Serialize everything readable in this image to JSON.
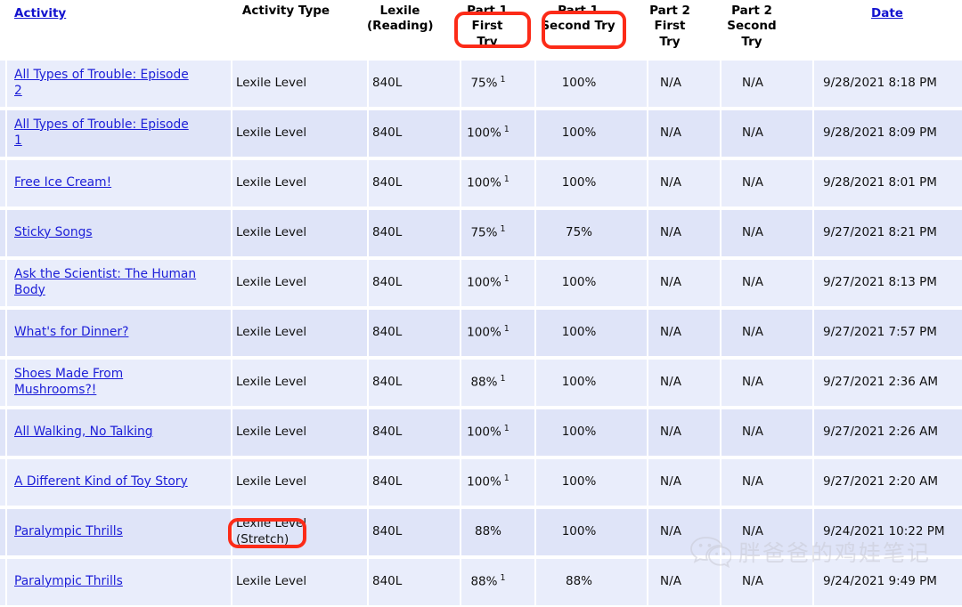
{
  "table": {
    "columns": [
      {
        "key": "activity",
        "label": "Activity",
        "type": "link",
        "align": "left"
      },
      {
        "key": "type",
        "label": "Activity Type",
        "type": "text",
        "align": "center"
      },
      {
        "key": "lexile",
        "label_line1": "Lexile",
        "label_line2": "(Reading)",
        "type": "text",
        "align": "center"
      },
      {
        "key": "p1first",
        "label_line1": "Part 1",
        "label_line2": "First Try",
        "type": "text",
        "align": "center"
      },
      {
        "key": "p1second",
        "label_line1": "Part 1",
        "label_line2": "Second Try",
        "type": "text",
        "align": "center"
      },
      {
        "key": "p2first",
        "label_line1": "Part 2",
        "label_line2": "First",
        "label_line3": "Try",
        "type": "text",
        "align": "center"
      },
      {
        "key": "p2second",
        "label_line1": "Part 2",
        "label_line2": "Second",
        "label_line3": "Try",
        "type": "text",
        "align": "center"
      },
      {
        "key": "date",
        "label": "Date",
        "type": "link",
        "align": "center"
      }
    ],
    "rows": [
      {
        "activity": "All Types of Trouble: Episode 2",
        "type": "Lexile Level",
        "type_sub": "",
        "lexile": "840L",
        "p1first": "75%",
        "p1first_sup": "1",
        "p1second": "100%",
        "p2first": "N/A",
        "p2second": "N/A",
        "date": "9/28/2021  8:18 PM"
      },
      {
        "activity": "All Types of Trouble: Episode 1",
        "type": "Lexile Level",
        "type_sub": "",
        "lexile": "840L",
        "p1first": "100%",
        "p1first_sup": "1",
        "p1second": "100%",
        "p2first": "N/A",
        "p2second": "N/A",
        "date": "9/28/2021  8:09 PM"
      },
      {
        "activity": "Free Ice Cream!",
        "type": "Lexile Level",
        "type_sub": "",
        "lexile": "840L",
        "p1first": "100%",
        "p1first_sup": "1",
        "p1second": "100%",
        "p2first": "N/A",
        "p2second": "N/A",
        "date": "9/28/2021  8:01 PM"
      },
      {
        "activity": "Sticky Songs",
        "type": "Lexile Level",
        "type_sub": "",
        "lexile": "840L",
        "p1first": "75%",
        "p1first_sup": "1",
        "p1second": "75%",
        "p2first": "N/A",
        "p2second": "N/A",
        "date": "9/27/2021  8:21 PM"
      },
      {
        "activity": "Ask the Scientist: The Human Body",
        "type": "Lexile Level",
        "type_sub": "",
        "lexile": "840L",
        "p1first": "100%",
        "p1first_sup": "1",
        "p1second": "100%",
        "p2first": "N/A",
        "p2second": "N/A",
        "date": "9/27/2021  8:13 PM"
      },
      {
        "activity": "What's for Dinner?",
        "type": "Lexile Level",
        "type_sub": "",
        "lexile": "840L",
        "p1first": "100%",
        "p1first_sup": "1",
        "p1second": "100%",
        "p2first": "N/A",
        "p2second": "N/A",
        "date": "9/27/2021  7:57 PM"
      },
      {
        "activity": "Shoes Made From Mushrooms?!",
        "type": "Lexile Level",
        "type_sub": "",
        "lexile": "840L",
        "p1first": "88%",
        "p1first_sup": "1",
        "p1second": "100%",
        "p2first": "N/A",
        "p2second": "N/A",
        "date": "9/27/2021  2:36 AM"
      },
      {
        "activity": "All Walking, No Talking",
        "type": "Lexile Level",
        "type_sub": "",
        "lexile": "840L",
        "p1first": "100%",
        "p1first_sup": "1",
        "p1second": "100%",
        "p2first": "N/A",
        "p2second": "N/A",
        "date": "9/27/2021  2:26 AM"
      },
      {
        "activity": "A Different Kind of Toy Story",
        "type": "Lexile Level",
        "type_sub": "",
        "lexile": "840L",
        "p1first": "100%",
        "p1first_sup": "1",
        "p1second": "100%",
        "p2first": "N/A",
        "p2second": "N/A",
        "date": "9/27/2021  2:20 AM"
      },
      {
        "activity": "Paralympic Thrills",
        "type": "Lexile Level",
        "type_sub": "(Stretch)",
        "lexile": "840L",
        "p1first": "88%",
        "p1first_sup": "",
        "p1second": "100%",
        "p2first": "N/A",
        "p2second": "N/A",
        "date": "9/24/2021 10:22 PM"
      },
      {
        "activity": "Paralympic Thrills",
        "type": "Lexile Level",
        "type_sub": "",
        "lexile": "840L",
        "p1first": "88%",
        "p1first_sup": "1",
        "p1second": "88%",
        "p2first": "N/A",
        "p2second": "N/A",
        "date": "9/24/2021  9:49 PM"
      }
    ]
  },
  "annotations": {
    "color": "#fc2b18",
    "boxes": [
      {
        "target": "Part 1 First Try header",
        "label": "First Try"
      },
      {
        "target": "Part 1 Second Try header",
        "label": "Second Try"
      },
      {
        "target": "Activity Type value",
        "label": "(Stretch)"
      }
    ]
  },
  "watermark": {
    "text": "胖爸爸的鸡娃笔记",
    "icon": "wechat-icon",
    "color": "#c9c9d4"
  },
  "colors": {
    "row_light": "#e9edfb",
    "row_dark": "#dfe4f8",
    "link": "#1e20d8",
    "header_link": "#1313cf",
    "annotation_red": "#fc2b18",
    "page_background": "#ffffff"
  }
}
